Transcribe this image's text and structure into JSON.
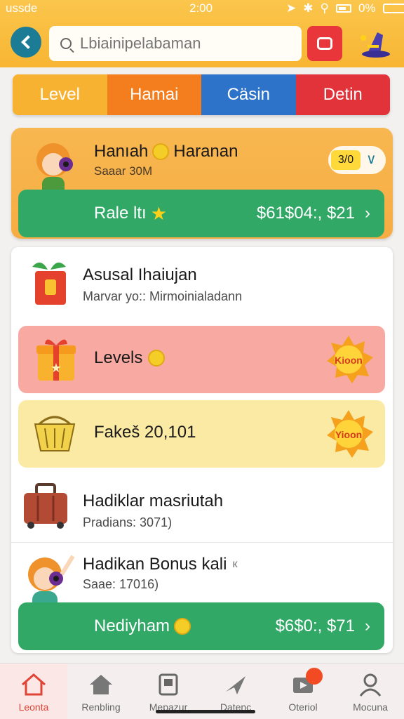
{
  "status": {
    "carrier": "ussde",
    "time": "2:00",
    "battery": "0%"
  },
  "header": {
    "search_placeholder": "Lbiainipelabaman"
  },
  "tabs": [
    "Level",
    "Hamai",
    "Cäsin",
    "Detin"
  ],
  "featured": {
    "title": "Hanıah",
    "title2": "Haranan",
    "subtitle": "Saaar 30M",
    "pill_value": "3/0",
    "cta_label": "Rale ltı",
    "cta_amount": "$61$04:, $21"
  },
  "list": {
    "header_title": "Asusal Ihaiujan",
    "header_sub": "Marvar yo:: Mirmoinialadann",
    "levels_label": "Levels",
    "levels_badge": "Kioon",
    "fakes_label": "Fakeš 20,101",
    "fakes_badge": "Yioon",
    "hadiklar_title": "Hadiklar masriutah",
    "hadiklar_sub": "Pradians: 3071)",
    "bonus_title": "Hadikan Bonus kali",
    "bonus_tag": "к",
    "bonus_sub": "Saae: 17016)",
    "bonus_cta_label": "Nediyham",
    "bonus_cta_amount": "$6$0:, $71"
  },
  "nav": [
    "Leonta",
    "Renbling",
    "Mepazur",
    "Datenc",
    "Oteriol",
    "Mocuna"
  ],
  "colors": {
    "accent": "#f7b533",
    "green": "#31a866",
    "pink": "#f7a9a2",
    "yellow": "#fbeaa4"
  }
}
